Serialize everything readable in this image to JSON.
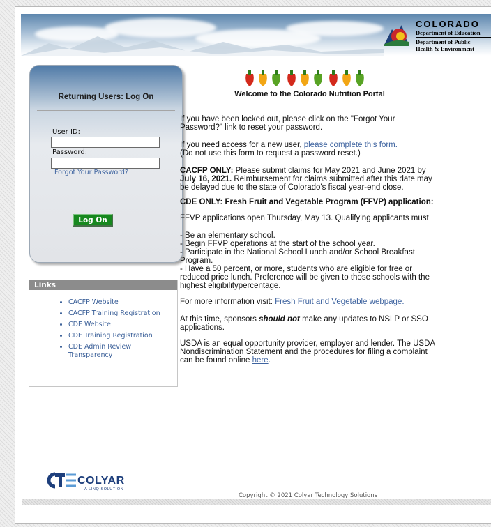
{
  "header": {
    "state": "COLORADO",
    "dept1": "Department of Education",
    "dept2_line1": "Department of Public",
    "dept2_line2": "Health & Environment"
  },
  "login": {
    "title": "Returning Users: Log On",
    "user_id_label": "User ID:",
    "password_label": "Password:",
    "user_id_value": "",
    "password_value": "",
    "forgot_link": "Forgot Your Password?",
    "logon_button": "Log On"
  },
  "links": {
    "header": "Links",
    "items": [
      {
        "label": "CACFP Website"
      },
      {
        "label": "CACFP Training Registration"
      },
      {
        "label": "CDE Website"
      },
      {
        "label": "CDE Training Registration"
      },
      {
        "label": "CDE Admin Review Transparency"
      }
    ]
  },
  "main": {
    "welcome": "Welcome to the Colorado Nutrition Portal",
    "locked_out": "If you have been locked out, please click on the \"Forgot Your Password?\" link to reset your password.",
    "new_user_prefix": "If you need access for a new user, ",
    "new_user_link": "please complete this form.",
    "new_user_note": "(Do not use this form to request a password reset.)",
    "cacfp_label": "CACFP ONLY:",
    "cacfp_text1": " Please submit claims for May 2021 and June 2021 by ",
    "cacfp_date": "July 16, 2021.",
    "cacfp_text2": "  Reimbursement for claims submitted after this date may be delayed due to the state of Colorado's fiscal year-end close.",
    "ffvp_heading": "CDE ONLY: Fresh Fruit and Vegetable Program (FFVP) application:",
    "ffvp_open": "FFVP applications open Thursday, May 13. Qualifying applicants must",
    "ffvp_req1": "- Be an elementary school.",
    "ffvp_req2": "- Begin FFVP operations at the start of the school year.",
    "ffvp_req3": "- Participate in the National School Lunch and/or School Breakfast Program.",
    "ffvp_req4": "- Have a 50 percent, or more, students who are eligible for free or reduced price lunch. Preference will be given to those schools with the highest eligibilitypercentage.",
    "more_info_prefix": "For more information visit: ",
    "more_info_link": "Fresh Fruit and Vegetable webpage.",
    "sponsors_prefix": "At this time, sponsors ",
    "sponsors_emph": "should not",
    "sponsors_suffix": " make any updates to NSLP or SSO applications.",
    "usda_text": "USDA is an equal opportunity provider, employer and lender. The USDA Nondiscrimination Statement and the procedures for filing a complaint can be found online ",
    "usda_link": "here",
    "usda_end": "."
  },
  "footer": {
    "logo_main": "COLYAR",
    "logo_sub": "A LINQ SOLUTION",
    "copyright": "Copyright © 2021 Colyar Technology Solutions"
  },
  "colors": {
    "link": "#3f64a0",
    "logon_green": "#17881f",
    "brand_blue": "#1e3f7c"
  }
}
